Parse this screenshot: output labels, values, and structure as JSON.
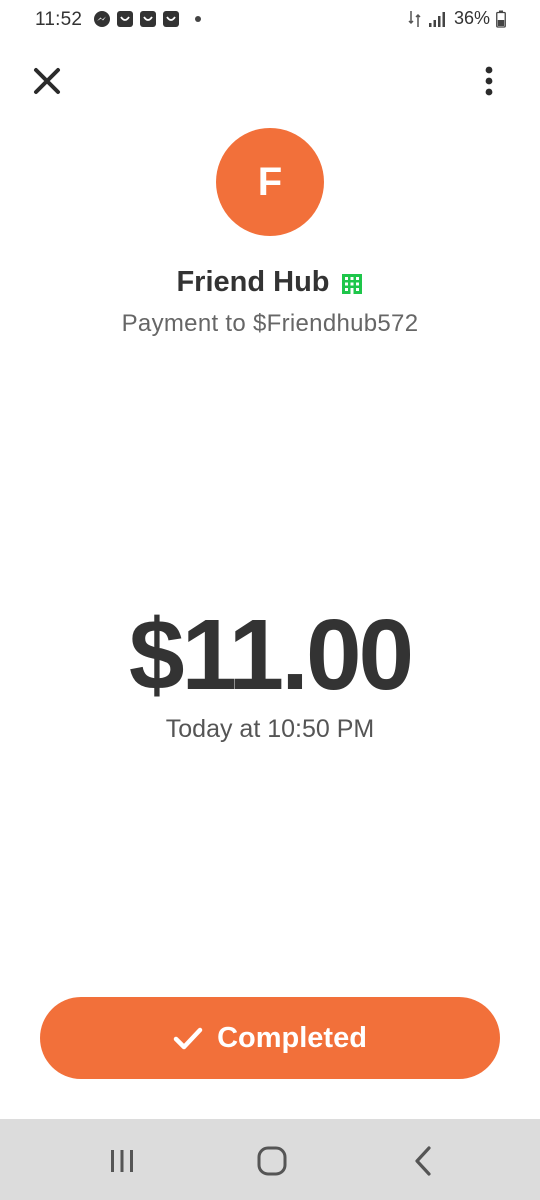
{
  "status_bar": {
    "time": "11:52",
    "battery_percent": "36%",
    "notification_icons": [
      "messenger-icon",
      "app-icon",
      "app-icon",
      "app-icon"
    ]
  },
  "header": {
    "close_icon": "close-icon",
    "more_icon": "more-vertical-icon"
  },
  "recipient": {
    "avatar_letter": "F",
    "name": "Friend Hub",
    "subtitle": "Payment to $Friendhub572",
    "business_icon": "business-building-icon"
  },
  "payment": {
    "amount": "$11.00",
    "timestamp": "Today at 10:50 PM"
  },
  "status_button": {
    "label": "Completed",
    "icon": "checkmark-icon"
  },
  "nav_bar": {
    "recents_icon": "recents-icon",
    "home_icon": "home-icon",
    "back_icon": "back-icon"
  },
  "colors": {
    "accent": "#f2703a",
    "business_badge": "#1ec64a",
    "text_primary": "#333333",
    "text_secondary": "#666666",
    "nav_bar_bg": "#dcdcdc"
  }
}
